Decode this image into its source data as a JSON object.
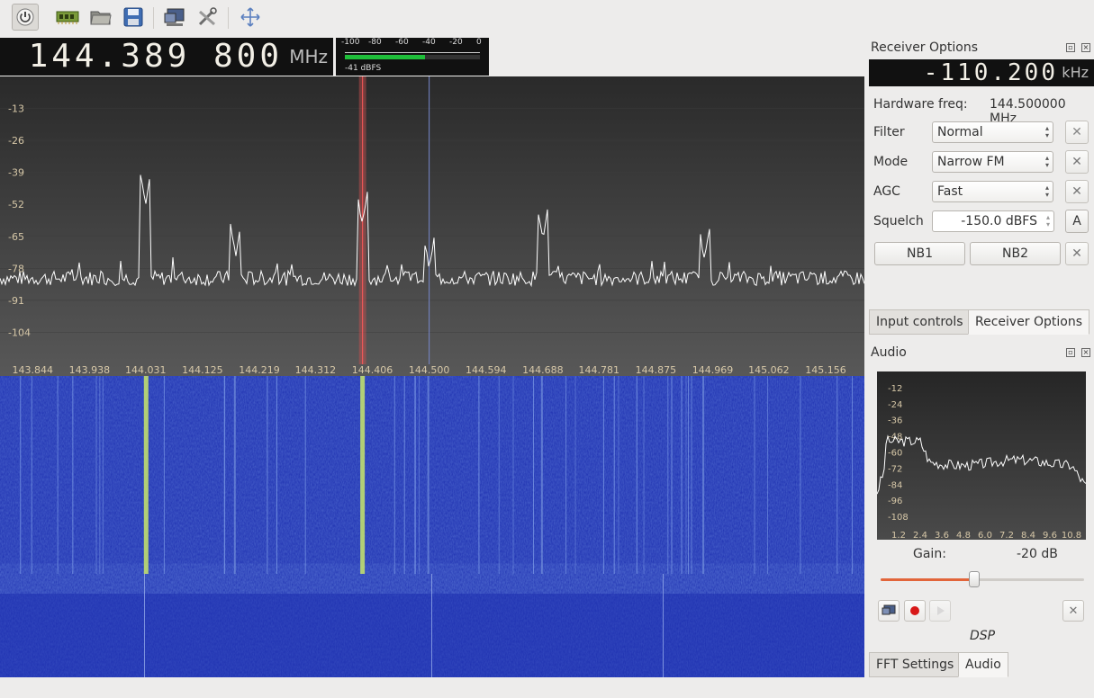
{
  "toolbar": {
    "buttons": [
      {
        "name": "start-stop",
        "icon": "power-icon"
      },
      {
        "name": "device-config",
        "icon": "hardware-board-icon"
      },
      {
        "name": "open-settings",
        "icon": "folder-icon"
      },
      {
        "name": "save-settings",
        "icon": "floppy-disk-icon"
      },
      {
        "name": "remote-control",
        "icon": "monitor-icon"
      },
      {
        "name": "configure",
        "icon": "tools-icon"
      },
      {
        "name": "fullscreen",
        "icon": "arrows-expand-icon"
      }
    ]
  },
  "frequency": {
    "value": "144.389 800",
    "unit": "MHz"
  },
  "meter": {
    "scale": [
      "-100",
      "-80",
      "-60",
      "-40",
      "-20",
      "0"
    ],
    "reading": "-41 dBFS",
    "level_fraction": 0.59
  },
  "chart_data": {
    "type": "line",
    "title": "",
    "x_ticks": [
      "143.844",
      "143.938",
      "144.031",
      "144.125",
      "144.219",
      "144.312",
      "144.406",
      "144.500",
      "144.594",
      "144.688",
      "144.781",
      "144.875",
      "144.969",
      "145.062",
      "145.156"
    ],
    "y_ticks": [
      "-13",
      "-26",
      "-39",
      "-52",
      "-65",
      "-78",
      "-91",
      "-104"
    ],
    "ylim": [
      -117,
      0
    ],
    "xlim": [
      143.79,
      145.22
    ],
    "noise_floor": -82,
    "peaks": [
      {
        "x": 144.031,
        "y": -52
      },
      {
        "x": 144.389,
        "y": -60
      },
      {
        "x": 144.5,
        "y": -78
      },
      {
        "x": 144.688,
        "y": -66
      },
      {
        "x": 144.955,
        "y": -74
      },
      {
        "x": 144.18,
        "y": -73
      }
    ],
    "demod_marker_x": 144.3898,
    "center_x": 144.5
  },
  "receiver_options": {
    "title": "Receiver Options",
    "offset": "-110.200",
    "offset_unit": "kHz",
    "hardware_freq_label": "Hardware freq:",
    "hardware_freq_value": "144.500000 MHz",
    "filter_label": "Filter",
    "filter_value": "Normal",
    "mode_label": "Mode",
    "mode_value": "Narrow FM",
    "agc_label": "AGC",
    "agc_value": "Fast",
    "squelch_label": "Squelch",
    "squelch_value": "-150.0 dBFS",
    "squelch_auto": "A",
    "nb1": "NB1",
    "nb2": "NB2"
  },
  "tabs_top": [
    {
      "label": "Input controls"
    },
    {
      "label": "Receiver Options"
    }
  ],
  "audio": {
    "title": "Audio",
    "chart": {
      "type": "line",
      "y_ticks": [
        "-12",
        "-24",
        "-36",
        "-48",
        "-60",
        "-72",
        "-84",
        "-96",
        "-108"
      ],
      "x_ticks": [
        "1.2",
        "2.4",
        "3.6",
        "4.8",
        "6.0",
        "7.2",
        "8.4",
        "9.6",
        "10.8"
      ],
      "ylim": [
        -114,
        0
      ],
      "xlim": [
        0,
        11.6
      ]
    },
    "gain_label": "Gain:",
    "gain_value": "-20 dB",
    "gain_fraction": 0.46,
    "dsp_label": "DSP"
  },
  "tabs_bottom": [
    {
      "label": "FFT Settings"
    },
    {
      "label": "Audio"
    }
  ]
}
